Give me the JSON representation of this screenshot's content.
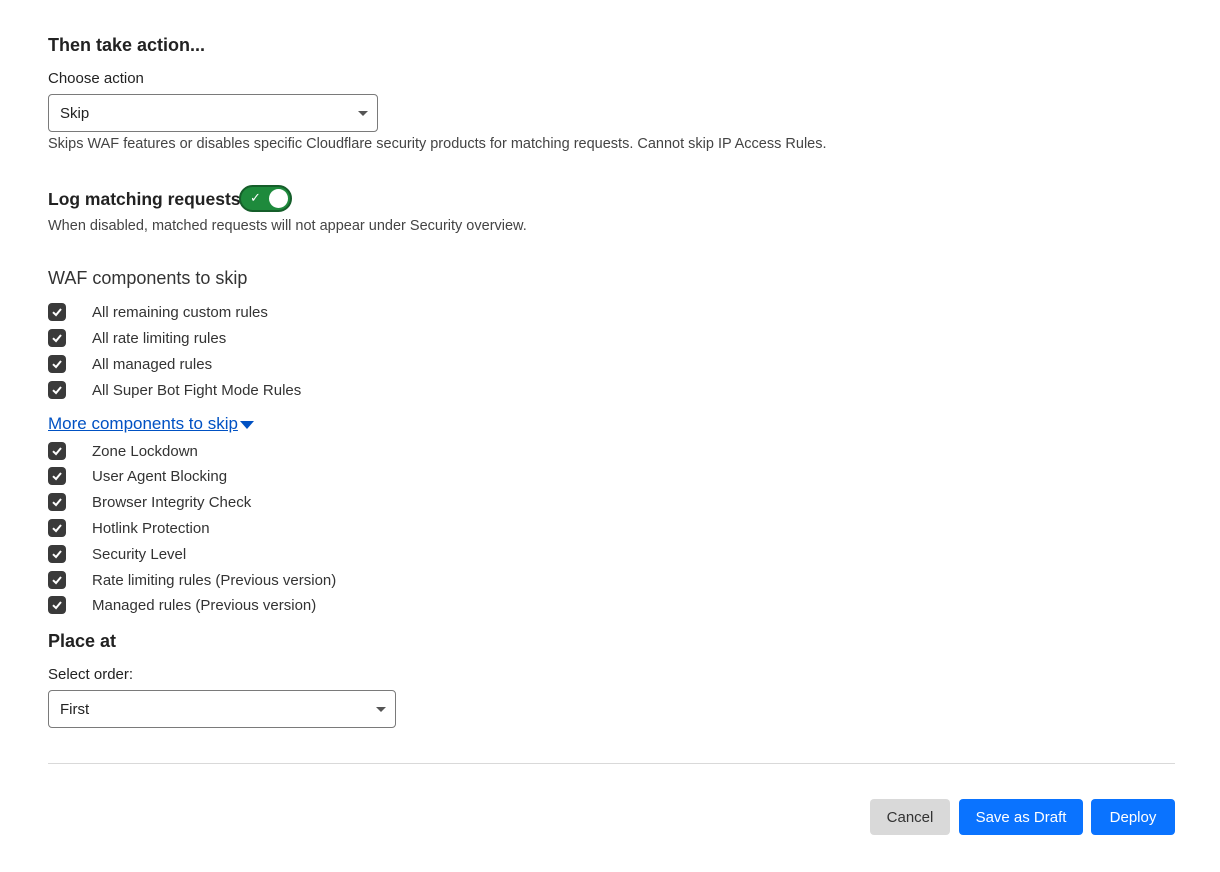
{
  "action_section": {
    "heading": "Then take action...",
    "choose_label": "Choose action",
    "choose_value": "Skip",
    "help": "Skips WAF features or disables specific Cloudflare security products for matching requests. Cannot skip IP Access Rules."
  },
  "log_section": {
    "label": "Log matching requests",
    "enabled": true,
    "help": "When disabled, matched requests will not appear under Security overview."
  },
  "waf_section": {
    "title": "WAF components to skip",
    "items": [
      {
        "label": "All remaining custom rules",
        "checked": true
      },
      {
        "label": "All rate limiting rules",
        "checked": true
      },
      {
        "label": "All managed rules",
        "checked": true
      },
      {
        "label": "All Super Bot Fight Mode Rules",
        "checked": true
      }
    ]
  },
  "more_section": {
    "link": "More components to skip",
    "items": [
      {
        "label": "Zone Lockdown",
        "checked": true
      },
      {
        "label": "User Agent Blocking",
        "checked": true
      },
      {
        "label": "Browser Integrity Check",
        "checked": true
      },
      {
        "label": "Hotlink Protection",
        "checked": true
      },
      {
        "label": "Security Level",
        "checked": true
      },
      {
        "label": "Rate limiting rules (Previous version)",
        "checked": true
      },
      {
        "label": "Managed rules (Previous version)",
        "checked": true
      }
    ]
  },
  "place_section": {
    "heading": "Place at",
    "order_label": "Select order:",
    "order_value": "First"
  },
  "footer": {
    "cancel": "Cancel",
    "save_draft": "Save as Draft",
    "deploy": "Deploy"
  },
  "colors": {
    "primary": "#0a73ff",
    "toggle_on": "#1e8a3c",
    "link": "#0051c3"
  }
}
